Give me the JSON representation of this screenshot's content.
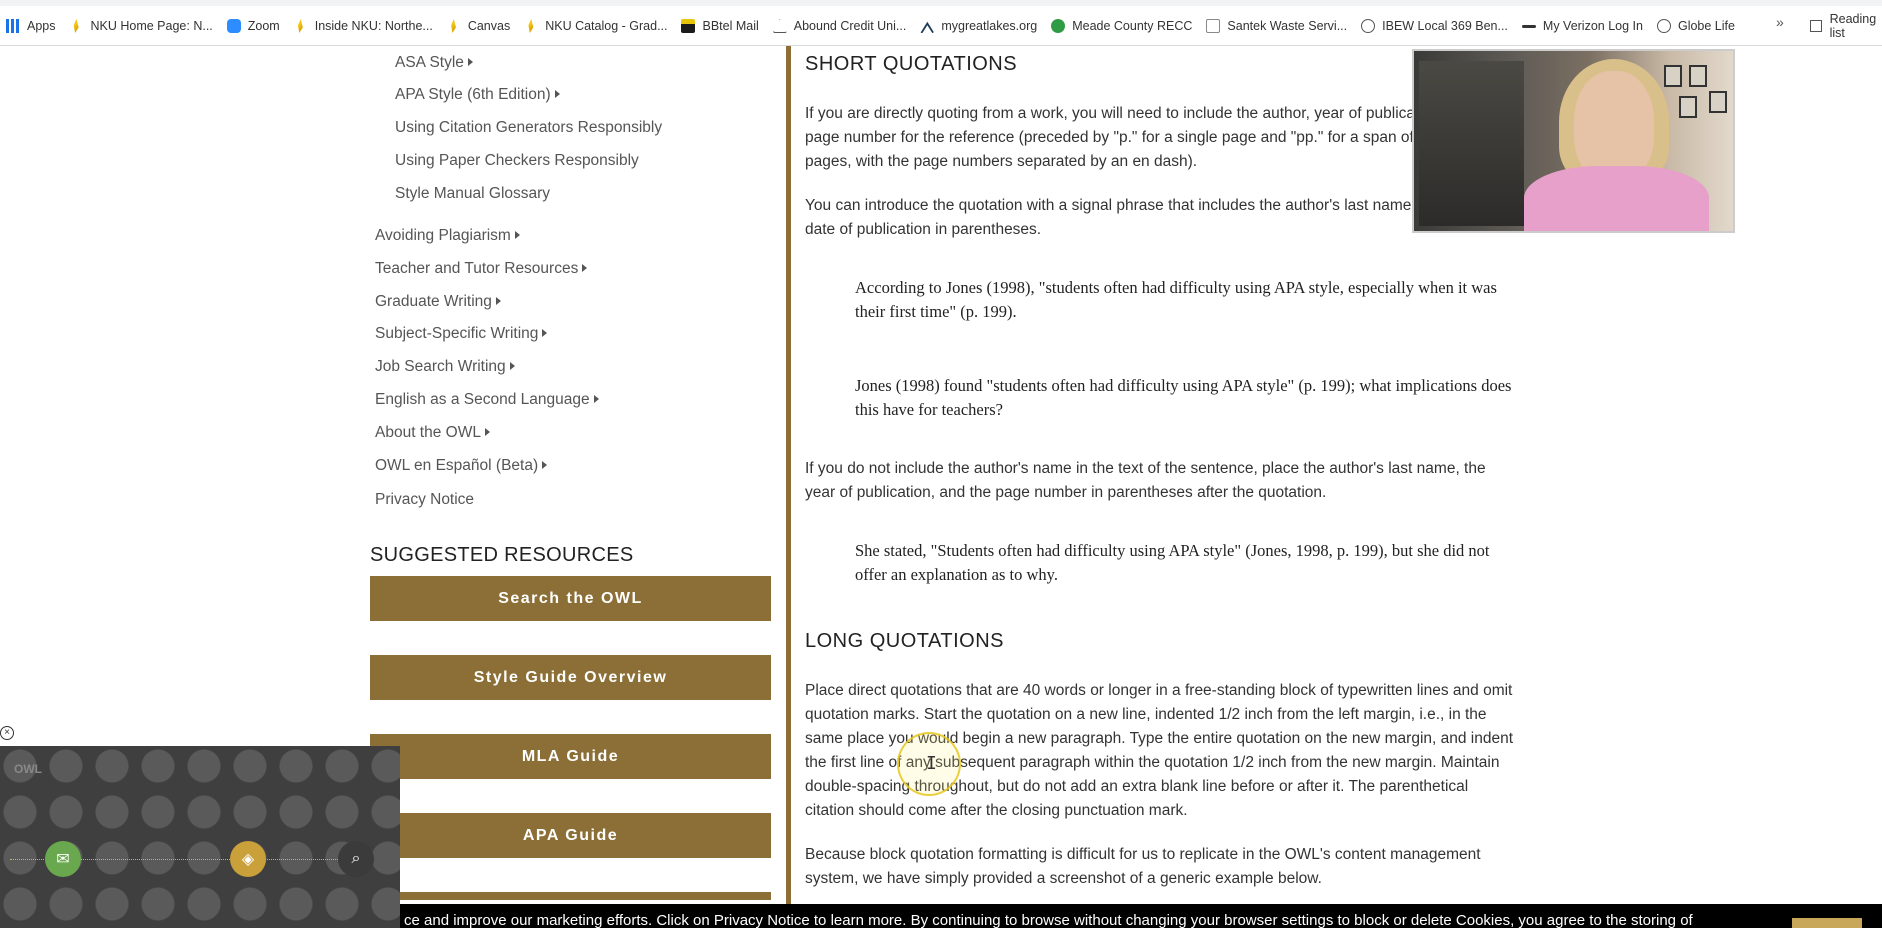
{
  "bookmarks": {
    "items": [
      {
        "label": "Apps",
        "icon": "apps-grid-icon"
      },
      {
        "label": "NKU Home Page: N...",
        "icon": "nku-icon"
      },
      {
        "label": "Zoom",
        "icon": "zoom-icon"
      },
      {
        "label": "Inside NKU: Northe...",
        "icon": "nku-icon"
      },
      {
        "label": "Canvas",
        "icon": "nku-icon"
      },
      {
        "label": "NKU Catalog - Grad...",
        "icon": "nku-icon"
      },
      {
        "label": "BBtel Mail",
        "icon": "bbtel-icon"
      },
      {
        "label": "Abound Credit Uni...",
        "icon": "abound-icon"
      },
      {
        "label": "mygreatlakes.org",
        "icon": "mygreatlakes-icon"
      },
      {
        "label": "Meade County RECC",
        "icon": "meade-icon"
      },
      {
        "label": "Santek Waste Servi...",
        "icon": "document-icon"
      },
      {
        "label": "IBEW Local 369 Ben...",
        "icon": "globe-icon"
      },
      {
        "label": "My Verizon Log In",
        "icon": "verizon-icon"
      },
      {
        "label": "Globe Life",
        "icon": "globe-icon"
      }
    ],
    "more": "»",
    "reading_list": "Reading list"
  },
  "sidebar": {
    "subitems": [
      "ASA Style",
      "APA Style (6th Edition)",
      "Using Citation Generators Responsibly",
      "Using Paper Checkers Responsibly",
      "Style Manual Glossary"
    ],
    "items": [
      "Avoiding Plagiarism",
      "Teacher and Tutor Resources",
      "Graduate Writing",
      "Subject-Specific Writing",
      "Job Search Writing",
      "English as a Second Language",
      "About the OWL",
      "OWL en Español (Beta)",
      "Privacy Notice"
    ],
    "suggested_title": "SUGGESTED RESOURCES",
    "resources": [
      "Search the OWL",
      "Style Guide Overview",
      "MLA Guide",
      "APA Guide"
    ]
  },
  "main": {
    "short_title": "SHORT QUOTATIONS",
    "short_p1": "If you are directly quoting from a work, you will need to include the author, year of publication, and the page number for the reference (preceded by \"p.\" for a single page and \"pp.\" for a span of multiple pages, with the page numbers separated by an en dash).",
    "short_p2": "You can introduce the quotation with a signal phrase that includes the author's last name followed by the date of publication in parentheses.",
    "quote1": "According to Jones (1998), \"students often had difficulty using APA style, especially when it was their first time\" (p. 199).",
    "quote2": "Jones (1998) found \"students often had difficulty using APA style\" (p. 199); what implications does this have for teachers?",
    "short_p3": "If you do not include the author's name in the text of the sentence, place the author's last name, the year of publication, and the page number in parentheses after the quotation.",
    "quote3": "She stated, \"Students often had difficulty using APA style\" (Jones, 1998, p. 199), but she did not offer an explanation as to why.",
    "long_title": "LONG QUOTATIONS",
    "long_p1": "Place direct quotations that are 40 words or longer in a free-standing block of typewritten lines and omit quotation marks. Start the quotation on a new line, indented 1/2 inch from the left margin, i.e., in the same place you would begin a new paragraph. Type the entire quotation on the new margin, and indent the first line of any subsequent paragraph within the quotation 1/2 inch from the new margin. Maintain double-spacing throughout, but do not add an extra blank line before or after it. The parenthetical citation should come after the closing punctuation mark.",
    "long_p2": "Because block quotation formatting is difficult for us to replicate in the OWL's content management system, we have simply provided a screenshot of a generic example below."
  },
  "owl": {
    "logo": "OWL",
    "close": "×"
  },
  "cookie": {
    "text": "ce and improve our marketing efforts. Click on Privacy Notice to learn more. By continuing to browse without changing your browser settings to block or delete Cookies, you agree to the storing of"
  },
  "colors": {
    "accent": "#8b6f36",
    "cookie_bg": "#000000"
  }
}
